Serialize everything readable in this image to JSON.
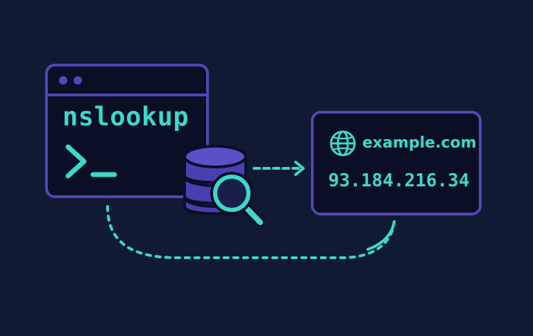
{
  "terminal": {
    "command": "nslookup"
  },
  "result": {
    "domain": "example.com",
    "ip": "93.184.216.34"
  },
  "icons": {
    "terminal_dots": "window-dots-icon",
    "prompt": "terminal-prompt-icon",
    "database": "database-icon",
    "search": "magnifier-icon",
    "globe": "globe-icon",
    "arrow": "arrow-right-icon"
  },
  "colors": {
    "background": "#111a33",
    "panel": "#0b0f26",
    "border": "#5146b8",
    "accent": "#3ed8c9",
    "database_fill": "#4a3fb0"
  }
}
